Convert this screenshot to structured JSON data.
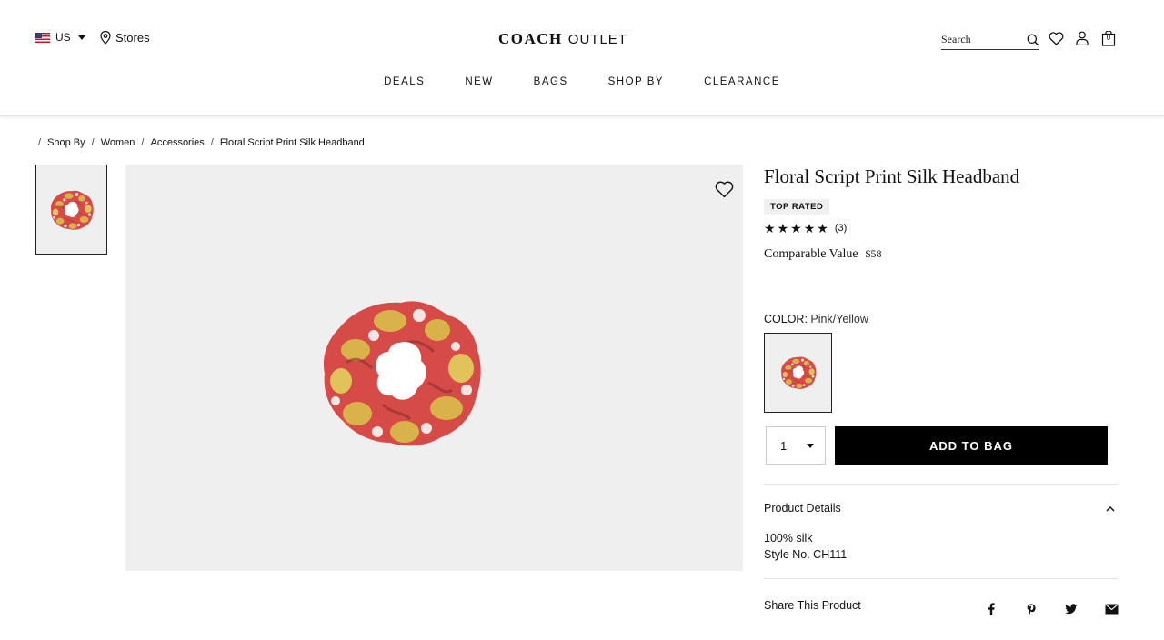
{
  "header": {
    "locale": "US",
    "stores_label": "Stores",
    "logo_brand": "COACH",
    "logo_sub": "OUTLET",
    "search_placeholder": "Search",
    "cart_count": "0",
    "nav": [
      "DEALS",
      "NEW",
      "BAGS",
      "SHOP BY",
      "CLEARANCE"
    ]
  },
  "breadcrumb": [
    "Shop By",
    "Women",
    "Accessories",
    "Floral Script Print Silk Headband"
  ],
  "product": {
    "title": "Floral Script Print Silk Headband",
    "badge": "TOP RATED",
    "rating": 5,
    "review_count": "(3)",
    "price_label": "Comparable Value",
    "price": "$58",
    "color_label": "COLOR:",
    "color_name": "Pink/Yellow",
    "quantity": "1",
    "add_to_bag": "ADD TO BAG",
    "details_title": "Product Details",
    "details": [
      "100% silk",
      "Style No. CH111"
    ],
    "share_label": "Share This Product",
    "share_icons": [
      "facebook-icon",
      "pinterest-icon",
      "twitter-icon",
      "email-icon"
    ]
  },
  "colors": {
    "primary": "#000000",
    "image_bg": "#efefef",
    "scrunchie_red": "#d9534a",
    "scrunchie_yellow": "#d8b24a"
  }
}
